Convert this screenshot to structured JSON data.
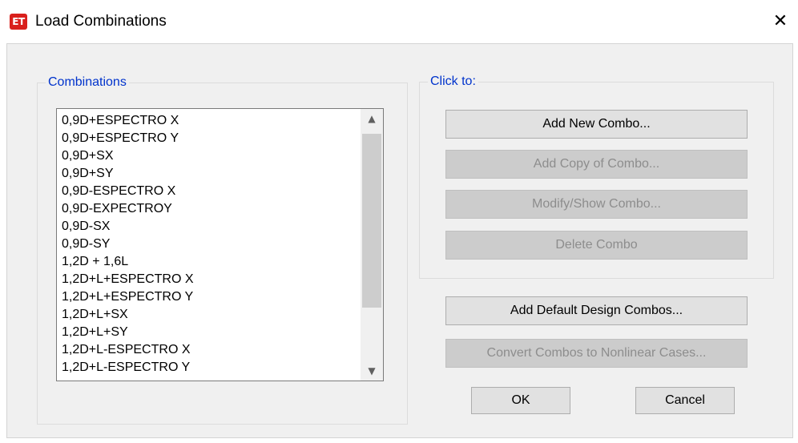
{
  "window": {
    "title": "Load Combinations",
    "app_icon_text": "ET",
    "close_glyph": "✕"
  },
  "combinations": {
    "legend": "Combinations",
    "items": [
      "0,9D+ESPECTRO X",
      "0,9D+ESPECTRO Y",
      "0,9D+SX",
      "0,9D+SY",
      "0,9D-ESPECTRO X",
      "0,9D-EXPECTROY",
      "0,9D-SX",
      "0,9D-SY",
      "1,2D + 1,6L",
      "1,2D+L+ESPECTRO X",
      "1,2D+L+ESPECTRO Y",
      "1,2D+L+SX",
      "1,2D+L+SY",
      "1,2D+L-ESPECTRO X",
      "1,2D+L-ESPECTRO Y"
    ],
    "scroll_up_glyph": "▲",
    "scroll_down_glyph": "▼"
  },
  "click_to": {
    "legend": "Click to:",
    "add_new": "Add New Combo...",
    "add_copy": "Add Copy of Combo...",
    "modify_show": "Modify/Show Combo...",
    "delete": "Delete Combo"
  },
  "actions": {
    "add_default": "Add Default Design Combos...",
    "convert": "Convert Combos to Nonlinear Cases...",
    "ok": "OK",
    "cancel": "Cancel"
  },
  "colors": {
    "legend_text": "#0033cc",
    "app_icon": "#d9201c",
    "disabled_text": "#8d8d8d"
  }
}
